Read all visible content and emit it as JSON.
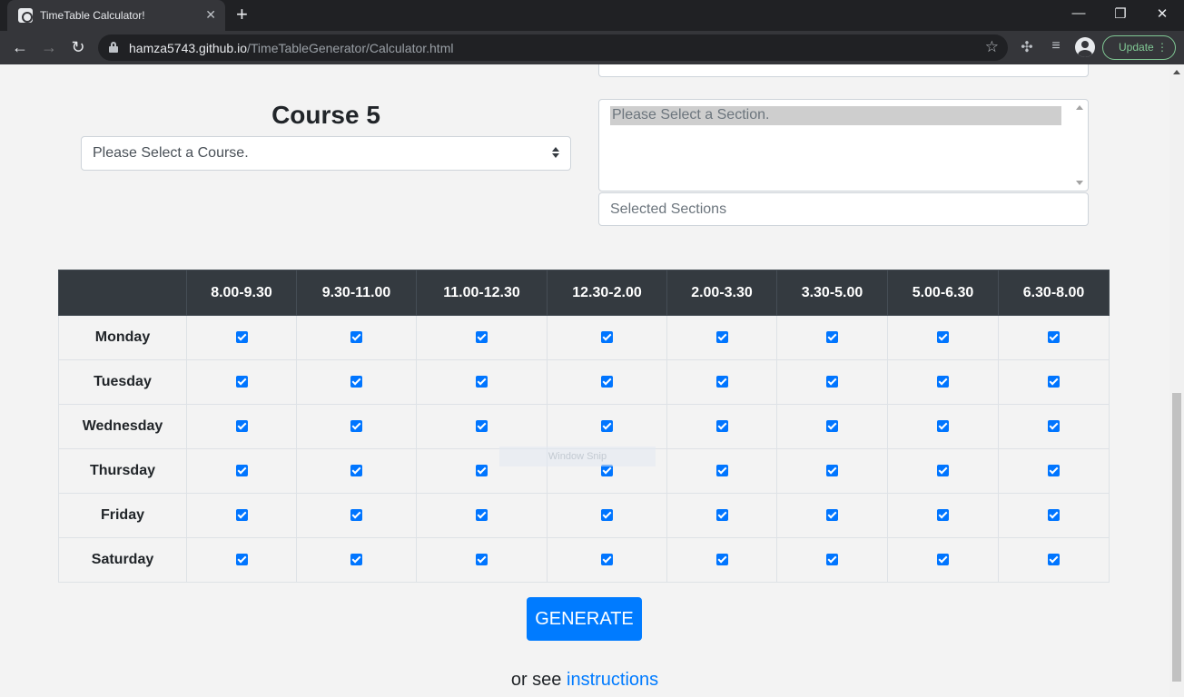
{
  "browser": {
    "tab_title": "TimeTable Calculator!",
    "tab_close": "✕",
    "new_tab": "+",
    "url_host": "hamza5743.github.io",
    "url_path": "/TimeTableGenerator/Calculator.html",
    "update_label": "Update",
    "window_controls": {
      "minimize": "—",
      "restore": "❐",
      "close": "✕"
    }
  },
  "form": {
    "selected_sections_top_placeholder": "Selected Sections",
    "course_title": "Course 5",
    "course_select_value": "Please Select a Course.",
    "section_option": "Please Select a Section.",
    "selected_sections_placeholder": "Selected Sections"
  },
  "timetable": {
    "time_slots": [
      "8.00-9.30",
      "9.30-11.00",
      "11.00-12.30",
      "12.30-2.00",
      "2.00-3.30",
      "3.30-5.00",
      "5.00-6.30",
      "6.30-8.00"
    ],
    "days": [
      "Monday",
      "Tuesday",
      "Wednesday",
      "Thursday",
      "Friday",
      "Saturday"
    ],
    "all_checked": true
  },
  "overlay": {
    "window_snap": "Window Snip"
  },
  "actions": {
    "generate_label": "GENERATE",
    "footer_text": "or see ",
    "instructions_link": "instructions"
  },
  "colors": {
    "primary": "#007bff",
    "table_header": "#343a40",
    "checkbox": "#0075ff"
  }
}
